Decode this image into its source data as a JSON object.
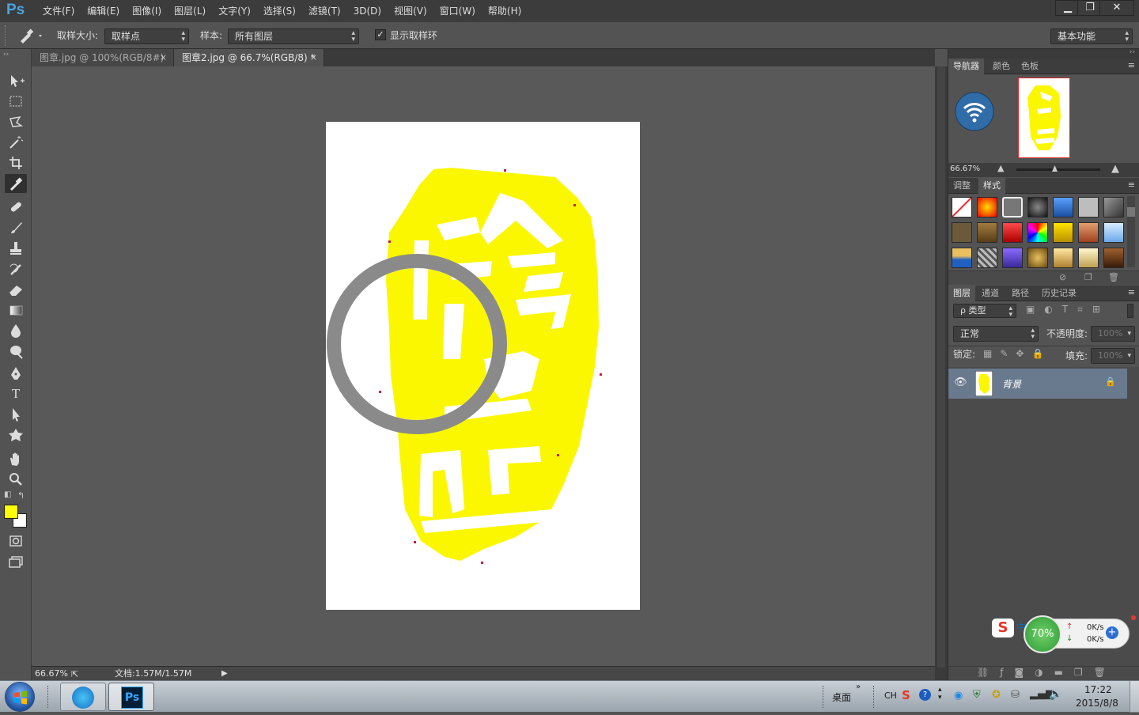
{
  "app": {
    "logo": "Ps"
  },
  "menu": [
    "文件(F)",
    "编辑(E)",
    "图像(I)",
    "图层(L)",
    "文字(Y)",
    "选择(S)",
    "滤镜(T)",
    "3D(D)",
    "视图(V)",
    "窗口(W)",
    "帮助(H)"
  ],
  "window_controls": {
    "minimize": "▁",
    "restore": "❐",
    "close": "✕"
  },
  "options": {
    "sample_size_label": "取样大小:",
    "sample_size_value": "取样点",
    "sample_label": "样本:",
    "sample_value": "所有图层",
    "show_ring_label": "显示取样环",
    "show_ring_checked": true,
    "workspace": "基本功能"
  },
  "colors": {
    "foreground": "#ffff00",
    "background": "#ffffff",
    "seal": "#faf700",
    "sample_ring": "#8a8a8a",
    "accent": "#4aa3df"
  },
  "doc_tabs": [
    {
      "label": "图章.jpg @ 100%(RGB/8#)",
      "close": "×",
      "active": false
    },
    {
      "label": "图章2.jpg @ 66.7%(RGB/8) *",
      "close": "×",
      "active": true
    }
  ],
  "canvas": {
    "seal_text_top": "珍",
    "seal_text_bottom": "品"
  },
  "status": {
    "zoom": "66.67%",
    "doc": "文档:1.57M/1.57M"
  },
  "navigator": {
    "tabs": [
      "导航器",
      "颜色",
      "色板"
    ],
    "zoom": "66.67%"
  },
  "adjust_panel": {
    "tabs": [
      "调整",
      "样式"
    ]
  },
  "layers_panel": {
    "tabs": [
      "图层",
      "通道",
      "路径",
      "历史记录"
    ],
    "filter_label": "ρ 类型",
    "blend_mode": "正常",
    "opacity_label": "不透明度:",
    "opacity_value": "100%",
    "lock_label": "锁定:",
    "fill_label": "填充:",
    "fill_value": "100%",
    "layers": [
      {
        "name": "背景",
        "visible": true,
        "locked": true
      }
    ]
  },
  "widget": {
    "percent": "70%",
    "up_speed": "0K/s",
    "down_speed": "0K/s"
  },
  "taskbar": {
    "desktop_label": "桌面",
    "lang": "CH",
    "time": "17:22",
    "date": "2015/8/8",
    "ps_label": "Ps"
  }
}
